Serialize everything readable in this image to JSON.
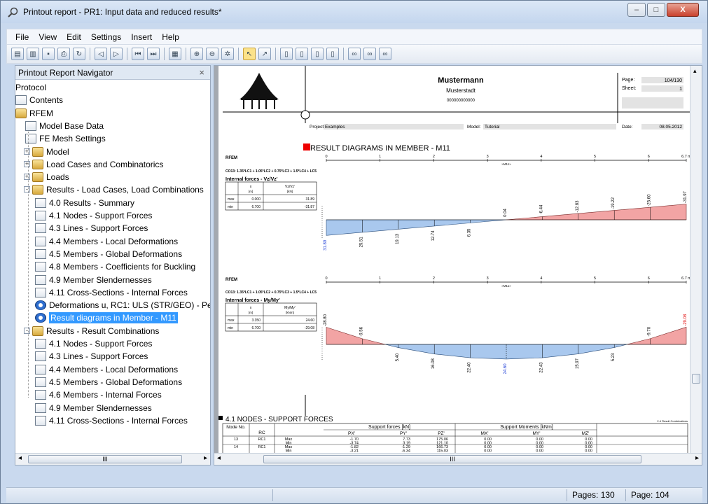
{
  "window": {
    "title": "Printout report - PR1: Input data and reduced results*",
    "min": "–",
    "max": "□",
    "close": "X"
  },
  "menu": [
    "File",
    "View",
    "Edit",
    "Settings",
    "Insert",
    "Help"
  ],
  "navigator": {
    "title": "Printout Report Navigator",
    "close": "×",
    "items": [
      {
        "label": "Protocol",
        "icon": "none",
        "level": 0
      },
      {
        "label": "Contents",
        "icon": "contents-icon",
        "level": 0
      },
      {
        "label": "RFEM",
        "icon": "folder-icon",
        "level": 0
      },
      {
        "label": "Model Base Data",
        "icon": "page-icon",
        "level": 1
      },
      {
        "label": "FE Mesh Settings",
        "icon": "page-icon",
        "level": 1
      },
      {
        "label": "Model",
        "icon": "folder-icon",
        "level": 1,
        "exp": "+"
      },
      {
        "label": "Load Cases and Combinatorics",
        "icon": "folder-icon",
        "level": 1,
        "exp": "+"
      },
      {
        "label": "Loads",
        "icon": "folder-icon",
        "level": 1,
        "exp": "+"
      },
      {
        "label": "Results - Load Cases, Load Combinations",
        "icon": "folder-icon",
        "level": 1,
        "exp": "-"
      },
      {
        "label": "4.0 Results - Summary",
        "icon": "page-icon",
        "level": 2
      },
      {
        "label": "4.1 Nodes - Support Forces",
        "icon": "page-icon",
        "level": 2
      },
      {
        "label": "4.3 Lines - Support Forces",
        "icon": "page-icon",
        "level": 2
      },
      {
        "label": "4.4 Members - Local Deformations",
        "icon": "page-icon",
        "level": 2
      },
      {
        "label": "4.5 Members - Global Deformations",
        "icon": "page-icon",
        "level": 2
      },
      {
        "label": "4.8 Members - Coefficients for Buckling",
        "icon": "page-icon",
        "level": 2
      },
      {
        "label": "4.9 Member Slendernesses",
        "icon": "page-icon",
        "level": 2
      },
      {
        "label": "4.11 Cross-Sections - Internal Forces",
        "icon": "page-icon",
        "level": 2
      },
      {
        "label": "Deformations u, RC1: ULS (STR/GEO) - Pe",
        "icon": "eye-icon",
        "level": 2
      },
      {
        "label": "Result diagrams in  Member -  M11",
        "icon": "eye-icon",
        "level": 2,
        "selected": true
      },
      {
        "label": "Results - Result Combinations",
        "icon": "folder-icon",
        "level": 1,
        "exp": "-"
      },
      {
        "label": "4.1 Nodes - Support Forces",
        "icon": "page-icon",
        "level": 2
      },
      {
        "label": "4.3 Lines - Support Forces",
        "icon": "page-icon",
        "level": 2
      },
      {
        "label": "4.4 Members - Local Deformations",
        "icon": "page-icon",
        "level": 2
      },
      {
        "label": "4.5 Members - Global Deformations",
        "icon": "page-icon",
        "level": 2
      },
      {
        "label": "4.6 Members - Internal Forces",
        "icon": "page-icon",
        "level": 2
      },
      {
        "label": "4.9 Member Slendernesses",
        "icon": "page-icon",
        "level": 2
      },
      {
        "label": "4.11 Cross-Sections - Internal Forces",
        "icon": "page-icon",
        "level": 2
      }
    ]
  },
  "page": {
    "company": "Mustermann",
    "city": "Musterstadt",
    "phone": "000000000000",
    "page_label": "Page:",
    "page_value": "104/130",
    "sheet_label": "Sheet:",
    "sheet_value": "1",
    "project_label": "Project:",
    "project_value": "Examples",
    "model_label": "Model:",
    "model_value": "Tutorial",
    "date_label": "Date:",
    "date_value": "08.05.2012",
    "section_title": "RESULT DIAGRAMS IN  MEMBER -  M11",
    "rfem": "RFEM",
    "axis_ticks": [
      "0",
      "1",
      "2",
      "3",
      "4",
      "5",
      "6",
      "6.7 m"
    ],
    "member": "»M11»",
    "combo": "CO13: 1.35*LC1 + 1.05*LC2 + 0.75*LC3 + 1.5*LC4 + LC5",
    "d1_title": "Internal forces - Vz/Vz'",
    "d1_head": [
      "x",
      "Vz/Vz'"
    ],
    "d1_units": [
      "[m]",
      "[kN]"
    ],
    "d1_rows": [
      [
        "max",
        "0.000",
        "31.89"
      ],
      [
        "min",
        "6.700",
        "-31.87"
      ]
    ],
    "d1_labels": [
      "31.89",
      "25.51",
      "19.13",
      "12.74",
      "6.35",
      "0.04",
      "-6.44",
      "-12.83",
      "-19.22",
      "-25.60",
      "-31.97"
    ],
    "d2_title": "Internal forces - My/My'",
    "d2_head": [
      "x",
      "My/My'"
    ],
    "d2_units": [
      "[m]",
      "[kNm]"
    ],
    "d2_rows": [
      [
        "max",
        "3.350",
        "24.60"
      ],
      [
        "min",
        "6.700",
        "-29.08"
      ]
    ],
    "d2_labels": [
      "-28.80",
      "-9.56",
      "5.40",
      "16.08",
      "22.40",
      "24.60",
      "22.43",
      "15.97",
      "5.23",
      "-9.70",
      "-29.08"
    ],
    "table_title": "4.1 NODES - SUPPORT FORCES",
    "table_note": "2.4 Result Combinations",
    "table_groups": [
      "Support forces [kN]",
      "Support Moments [kNm]"
    ],
    "table_cols": [
      "Node No.",
      "RC",
      "",
      "PX'",
      "PY'",
      "PZ'",
      "MX'",
      "MY'",
      "MZ'"
    ],
    "table_rows": [
      [
        "13",
        "RC1",
        "Max",
        "-1.70",
        "7.73",
        "175.06",
        "0.00",
        "0.00",
        "0.00"
      ],
      [
        "",
        "",
        "Min",
        "-3.74",
        "3.19",
        "121.10",
        "0.00",
        "0.00",
        "0.00"
      ],
      [
        "14",
        "RC1",
        "Max",
        "-1.82",
        "-1.29",
        "166.73",
        "0.00",
        "0.00",
        "0.00"
      ],
      [
        "",
        "",
        "Min",
        "-3.21",
        "-6.34",
        "115.03",
        "0.00",
        "0.00",
        "0.00"
      ]
    ]
  },
  "status": {
    "pages": "Pages: 130",
    "page": "Page: 104"
  },
  "scroll": {
    "thumb": "III"
  }
}
